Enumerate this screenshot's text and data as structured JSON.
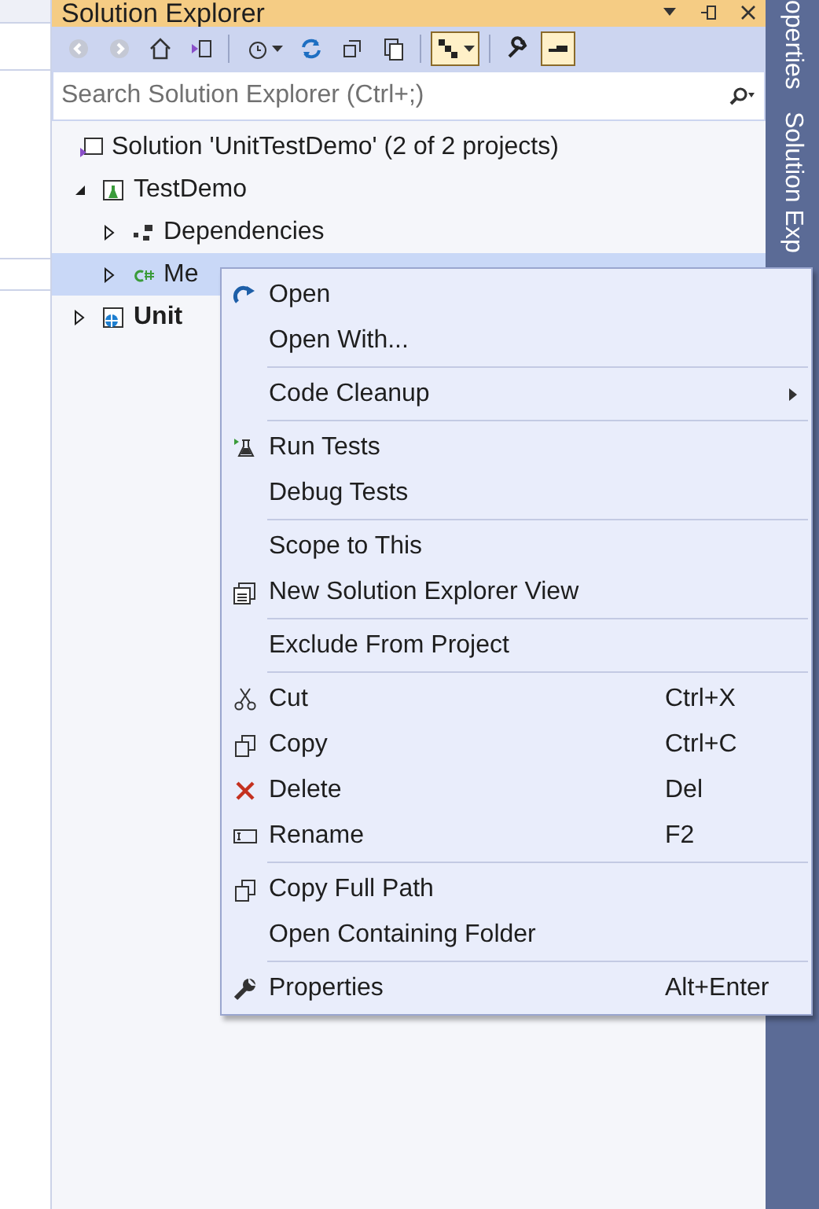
{
  "window": {
    "title": "Solution Explorer"
  },
  "side_tabs": [
    {
      "label": "operties"
    },
    {
      "label": "Solution Exp"
    }
  ],
  "toolbar": [
    {
      "on": false
    },
    {
      "on": false
    },
    {
      "on": false
    },
    {
      "on": false
    },
    {
      "on": false
    },
    {
      "on": false
    },
    {
      "on": false
    },
    {
      "on": false
    },
    {
      "on": true
    },
    {
      "on": false
    },
    {
      "on": true
    }
  ],
  "search": {
    "placeholder": "Search Solution Explorer (Ctrl+;)"
  },
  "tree": [
    {
      "label": "Solution 'UnitTestDemo' (2 of 2 projects)",
      "selected": false,
      "startup": false,
      "children": [
        {
          "label": "TestDemo",
          "selected": false,
          "startup": false,
          "expanded": true,
          "children": [
            {
              "label": "Dependencies",
              "selected": false,
              "startup": false,
              "expanded": false
            },
            {
              "label": "Me",
              "selected": true,
              "startup": false,
              "expanded": false
            }
          ]
        },
        {
          "label": "Unit",
          "selected": false,
          "startup": true,
          "expanded": false
        }
      ]
    }
  ],
  "context_menu": [
    {
      "kind": "item",
      "label": "Open"
    },
    {
      "kind": "item",
      "label": "Open With..."
    },
    {
      "kind": "separator"
    },
    {
      "kind": "item",
      "label": "Code Cleanup",
      "submenu": true
    },
    {
      "kind": "separator"
    },
    {
      "kind": "item",
      "label": "Run Tests"
    },
    {
      "kind": "item",
      "label": "Debug Tests"
    },
    {
      "kind": "separator"
    },
    {
      "kind": "item",
      "label": "Scope to This"
    },
    {
      "kind": "item",
      "label": "New Solution Explorer View"
    },
    {
      "kind": "separator"
    },
    {
      "kind": "item",
      "label": "Exclude From Project"
    },
    {
      "kind": "separator"
    },
    {
      "kind": "item",
      "label": "Cut",
      "shortcut": "Ctrl+X"
    },
    {
      "kind": "item",
      "label": "Copy",
      "shortcut": "Ctrl+C"
    },
    {
      "kind": "item",
      "label": "Delete",
      "shortcut": "Del"
    },
    {
      "kind": "item",
      "label": "Rename",
      "shortcut": "F2"
    },
    {
      "kind": "separator"
    },
    {
      "kind": "item",
      "label": "Copy Full Path"
    },
    {
      "kind": "item",
      "label": "Open Containing Folder"
    },
    {
      "kind": "separator"
    },
    {
      "kind": "item",
      "label": "Properties",
      "shortcut": "Alt+Enter"
    }
  ]
}
